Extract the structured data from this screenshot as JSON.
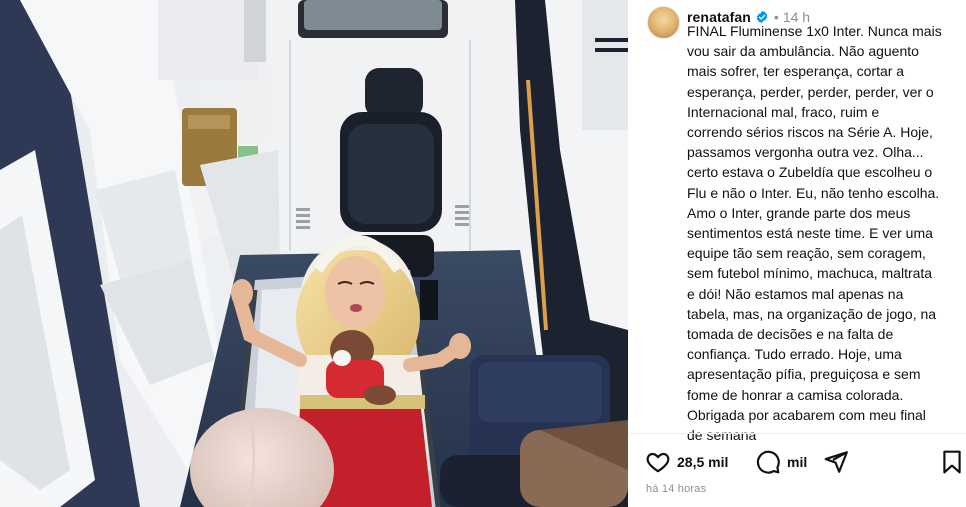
{
  "post": {
    "username": "renatafan",
    "separator": "•",
    "time": "14 h",
    "caption_lines": [
      "FINAL Fluminense 1x0 Inter. Nunca mais",
      "vou sair da ambulância. Não aguento",
      "mais sofrer, ter esperança, cortar a",
      "esperança, perder, perder, perder, ver o",
      "Internacional mal, fraco, ruim e",
      "correndo sérios riscos na Série A. Hoje,",
      "passamos vergonha outra vez. Olha...",
      "certo estava o Zubeldía que escolheu o",
      "Flu e não o Inter. Eu, não tenho escolha.",
      "Amo o Inter, grande parte dos meus",
      "sentimentos está neste time. E ver uma",
      "equipe tão sem reação, sem coragem,",
      "sem futebol mínimo, machuca, maltrata",
      "e dói! Não estamos mal apenas na",
      "tabela, mas, na organização de jogo, na",
      "tomada de decisões e na falta de",
      "confiança. Tudo errado. Hoje, uma",
      "apresentação pífia, preguiçosa e sem",
      "fome de honrar a camisa colorada.",
      "Obrigada por acabarem com meu final",
      "de semana"
    ],
    "likes": "28,5 mil",
    "comments": "mil",
    "posted_ago": "há 14 horas"
  },
  "icons": {
    "like": "heart-icon",
    "comment": "comment-icon",
    "share": "share-icon",
    "save": "bookmark-icon",
    "verified": "verified-badge-icon"
  },
  "colors": {
    "verified": "#0095f6",
    "text": "#111111",
    "muted": "#8e8e8e"
  }
}
